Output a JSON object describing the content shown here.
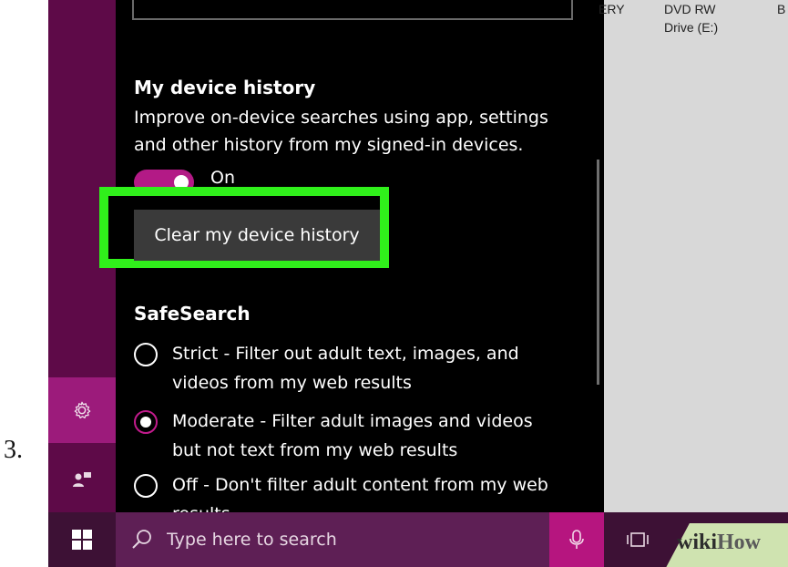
{
  "step": {
    "number": "3."
  },
  "panel": {
    "device_history": {
      "heading": "My device history",
      "description_line1": "Improve on-device searches using app, settings",
      "description_line2": "and other history from my signed-in devices.",
      "toggle_state": "On",
      "toggle_on": true,
      "clear_button": "Clear my device history"
    },
    "safesearch": {
      "heading": "SafeSearch",
      "options": [
        {
          "line1": "Strict - Filter out adult text, images, and",
          "line2": "videos from my web results",
          "checked": false
        },
        {
          "line1": "Moderate - Filter adult images and videos",
          "line2": "but not text from my web results",
          "checked": true
        },
        {
          "line1": "Off - Don't filter adult content from my web",
          "line2": "results",
          "checked": false
        }
      ]
    }
  },
  "explorer": {
    "col1": "ERY",
    "col2_line1": "DVD RW",
    "col2_line2": "Drive (E:)",
    "col3": "B"
  },
  "rail": {
    "settings_icon": "gear-icon",
    "feedback_icon": "feedback-icon"
  },
  "taskbar": {
    "search_placeholder": "Type here to search",
    "start_icon": "windows-logo-icon",
    "mic_icon": "microphone-icon",
    "task_view_icon": "task-view-icon"
  },
  "watermark": {
    "part1": "wiki",
    "part2": "How"
  },
  "colors": {
    "highlight": "#30f01b",
    "accent": "#b31a86",
    "rail": "#5e0a48",
    "search_box": "#5e1f55"
  }
}
